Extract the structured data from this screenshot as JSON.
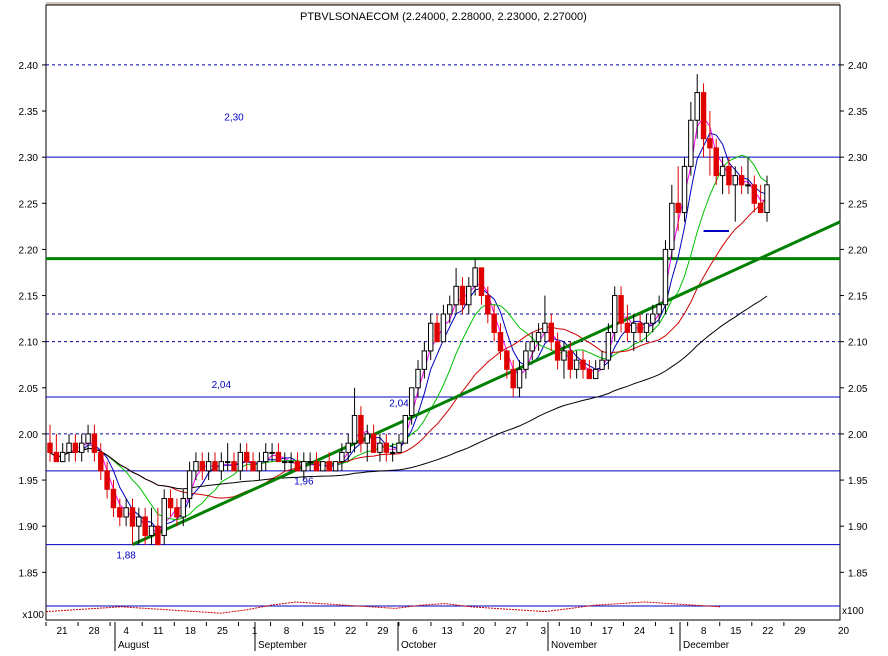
{
  "chart_data": {
    "type": "candlestick",
    "title": "PTBVLSONAECOM (2.24000, 2.28000, 2.23000, 2.27000)",
    "y_axis": {
      "min": 1.82,
      "max": 2.44,
      "ticks": [
        "2.40",
        "2.35",
        "2.30",
        "2.25",
        "2.20",
        "2.15",
        "2.10",
        "2.05",
        "2.00",
        "1.95",
        "1.90",
        "1.85"
      ],
      "tick_values": [
        2.4,
        2.35,
        2.3,
        2.25,
        2.2,
        2.15,
        2.1,
        2.05,
        2.0,
        1.95,
        1.9,
        1.85
      ]
    },
    "x_axis": {
      "day_labels": [
        "21",
        "28",
        "4",
        "11",
        "18",
        "25",
        "1",
        "8",
        "15",
        "22",
        "29",
        "6",
        "13",
        "20",
        "27",
        "3",
        "10",
        "17",
        "24",
        "1",
        "8",
        "15",
        "22",
        "29"
      ],
      "month_labels": [
        "August",
        "September",
        "October",
        "November",
        "December"
      ],
      "edge_label": "20"
    },
    "candles": [
      {
        "o": 1.99,
        "h": 2.01,
        "l": 1.97,
        "c": 1.98
      },
      {
        "o": 1.98,
        "h": 2.0,
        "l": 1.97,
        "c": 1.97
      },
      {
        "o": 1.97,
        "h": 1.99,
        "l": 1.97,
        "c": 1.98
      },
      {
        "o": 1.98,
        "h": 2.0,
        "l": 1.97,
        "c": 1.99
      },
      {
        "o": 1.99,
        "h": 2.0,
        "l": 1.97,
        "c": 1.98
      },
      {
        "o": 1.98,
        "h": 2.0,
        "l": 1.97,
        "c": 1.99
      },
      {
        "o": 1.99,
        "h": 2.01,
        "l": 1.98,
        "c": 2.0
      },
      {
        "o": 2.0,
        "h": 2.01,
        "l": 1.97,
        "c": 1.98
      },
      {
        "o": 1.98,
        "h": 1.99,
        "l": 1.95,
        "c": 1.96
      },
      {
        "o": 1.96,
        "h": 1.97,
        "l": 1.93,
        "c": 1.94
      },
      {
        "o": 1.94,
        "h": 1.95,
        "l": 1.91,
        "c": 1.92
      },
      {
        "o": 1.92,
        "h": 1.93,
        "l": 1.9,
        "c": 1.91
      },
      {
        "o": 1.91,
        "h": 1.93,
        "l": 1.9,
        "c": 1.92
      },
      {
        "o": 1.92,
        "h": 1.93,
        "l": 1.88,
        "c": 1.9
      },
      {
        "o": 1.9,
        "h": 1.92,
        "l": 1.88,
        "c": 1.91
      },
      {
        "o": 1.91,
        "h": 1.92,
        "l": 1.88,
        "c": 1.89
      },
      {
        "o": 1.89,
        "h": 1.92,
        "l": 1.88,
        "c": 1.9
      },
      {
        "o": 1.9,
        "h": 1.92,
        "l": 1.88,
        "c": 1.88
      },
      {
        "o": 1.89,
        "h": 1.94,
        "l": 1.88,
        "c": 1.93
      },
      {
        "o": 1.93,
        "h": 1.94,
        "l": 1.91,
        "c": 1.92
      },
      {
        "o": 1.92,
        "h": 1.93,
        "l": 1.9,
        "c": 1.91
      },
      {
        "o": 1.91,
        "h": 1.94,
        "l": 1.9,
        "c": 1.93
      },
      {
        "o": 1.93,
        "h": 1.97,
        "l": 1.92,
        "c": 1.96
      },
      {
        "o": 1.96,
        "h": 1.98,
        "l": 1.95,
        "c": 1.97
      },
      {
        "o": 1.97,
        "h": 1.98,
        "l": 1.95,
        "c": 1.96
      },
      {
        "o": 1.96,
        "h": 1.98,
        "l": 1.95,
        "c": 1.97
      },
      {
        "o": 1.97,
        "h": 1.98,
        "l": 1.96,
        "c": 1.96
      },
      {
        "o": 1.96,
        "h": 1.98,
        "l": 1.95,
        "c": 1.97
      },
      {
        "o": 1.97,
        "h": 1.99,
        "l": 1.96,
        "c": 1.97
      },
      {
        "o": 1.97,
        "h": 1.98,
        "l": 1.96,
        "c": 1.96
      },
      {
        "o": 1.96,
        "h": 1.99,
        "l": 1.95,
        "c": 1.98
      },
      {
        "o": 1.98,
        "h": 1.99,
        "l": 1.96,
        "c": 1.97
      },
      {
        "o": 1.97,
        "h": 1.98,
        "l": 1.96,
        "c": 1.96
      },
      {
        "o": 1.96,
        "h": 1.98,
        "l": 1.95,
        "c": 1.97
      },
      {
        "o": 1.97,
        "h": 1.99,
        "l": 1.96,
        "c": 1.98
      },
      {
        "o": 1.98,
        "h": 1.99,
        "l": 1.97,
        "c": 1.98
      },
      {
        "o": 1.98,
        "h": 1.99,
        "l": 1.97,
        "c": 1.97
      },
      {
        "o": 1.97,
        "h": 1.98,
        "l": 1.96,
        "c": 1.97
      },
      {
        "o": 1.97,
        "h": 1.98,
        "l": 1.96,
        "c": 1.97
      },
      {
        "o": 1.97,
        "h": 1.98,
        "l": 1.96,
        "c": 1.96
      },
      {
        "o": 1.96,
        "h": 1.98,
        "l": 1.95,
        "c": 1.97
      },
      {
        "o": 1.97,
        "h": 1.98,
        "l": 1.96,
        "c": 1.97
      },
      {
        "o": 1.97,
        "h": 1.98,
        "l": 1.96,
        "c": 1.96
      },
      {
        "o": 1.96,
        "h": 1.97,
        "l": 1.96,
        "c": 1.97
      },
      {
        "o": 1.97,
        "h": 1.98,
        "l": 1.96,
        "c": 1.96
      },
      {
        "o": 1.96,
        "h": 1.97,
        "l": 1.96,
        "c": 1.97
      },
      {
        "o": 1.97,
        "h": 1.99,
        "l": 1.96,
        "c": 1.98
      },
      {
        "o": 1.98,
        "h": 2.0,
        "l": 1.97,
        "c": 1.99
      },
      {
        "o": 1.99,
        "h": 2.05,
        "l": 1.98,
        "c": 2.02
      },
      {
        "o": 2.02,
        "h": 2.03,
        "l": 1.98,
        "c": 1.99
      },
      {
        "o": 1.99,
        "h": 2.01,
        "l": 1.97,
        "c": 2.0
      },
      {
        "o": 2.0,
        "h": 2.01,
        "l": 1.98,
        "c": 1.98
      },
      {
        "o": 1.98,
        "h": 2.0,
        "l": 1.97,
        "c": 1.99
      },
      {
        "o": 1.99,
        "h": 2.0,
        "l": 1.97,
        "c": 1.98
      },
      {
        "o": 1.98,
        "h": 1.99,
        "l": 1.97,
        "c": 1.98
      },
      {
        "o": 1.98,
        "h": 2.0,
        "l": 1.98,
        "c": 1.99
      },
      {
        "o": 1.99,
        "h": 2.02,
        "l": 1.99,
        "c": 2.02
      },
      {
        "o": 2.02,
        "h": 2.05,
        "l": 2.01,
        "c": 2.05
      },
      {
        "o": 2.05,
        "h": 2.08,
        "l": 2.04,
        "c": 2.07
      },
      {
        "o": 2.07,
        "h": 2.1,
        "l": 2.06,
        "c": 2.09
      },
      {
        "o": 2.09,
        "h": 2.13,
        "l": 2.08,
        "c": 2.12
      },
      {
        "o": 2.12,
        "h": 2.13,
        "l": 2.1,
        "c": 2.1
      },
      {
        "o": 2.1,
        "h": 2.14,
        "l": 2.1,
        "c": 2.13
      },
      {
        "o": 2.13,
        "h": 2.15,
        "l": 2.12,
        "c": 2.14
      },
      {
        "o": 2.14,
        "h": 2.18,
        "l": 2.13,
        "c": 2.16
      },
      {
        "o": 2.16,
        "h": 2.17,
        "l": 2.13,
        "c": 2.14
      },
      {
        "o": 2.14,
        "h": 2.17,
        "l": 2.13,
        "c": 2.16
      },
      {
        "o": 2.16,
        "h": 2.19,
        "l": 2.15,
        "c": 2.18
      },
      {
        "o": 2.18,
        "h": 2.18,
        "l": 2.14,
        "c": 2.15
      },
      {
        "o": 2.15,
        "h": 2.16,
        "l": 2.12,
        "c": 2.13
      },
      {
        "o": 2.13,
        "h": 2.14,
        "l": 2.1,
        "c": 2.11
      },
      {
        "o": 2.11,
        "h": 2.12,
        "l": 2.08,
        "c": 2.09
      },
      {
        "o": 2.09,
        "h": 2.09,
        "l": 2.06,
        "c": 2.07
      },
      {
        "o": 2.07,
        "h": 2.08,
        "l": 2.04,
        "c": 2.05
      },
      {
        "o": 2.05,
        "h": 2.08,
        "l": 2.04,
        "c": 2.07
      },
      {
        "o": 2.07,
        "h": 2.1,
        "l": 2.06,
        "c": 2.09
      },
      {
        "o": 2.09,
        "h": 2.11,
        "l": 2.08,
        "c": 2.1
      },
      {
        "o": 2.1,
        "h": 2.12,
        "l": 2.09,
        "c": 2.11
      },
      {
        "o": 2.11,
        "h": 2.15,
        "l": 2.1,
        "c": 2.12
      },
      {
        "o": 2.12,
        "h": 2.13,
        "l": 2.09,
        "c": 2.1
      },
      {
        "o": 2.1,
        "h": 2.11,
        "l": 2.07,
        "c": 2.08
      },
      {
        "o": 2.08,
        "h": 2.1,
        "l": 2.06,
        "c": 2.09
      },
      {
        "o": 2.09,
        "h": 2.1,
        "l": 2.06,
        "c": 2.07
      },
      {
        "o": 2.07,
        "h": 2.09,
        "l": 2.06,
        "c": 2.08
      },
      {
        "o": 2.08,
        "h": 2.09,
        "l": 2.06,
        "c": 2.07
      },
      {
        "o": 2.07,
        "h": 2.08,
        "l": 2.06,
        "c": 2.06
      },
      {
        "o": 2.06,
        "h": 2.08,
        "l": 2.06,
        "c": 2.07
      },
      {
        "o": 2.07,
        "h": 2.09,
        "l": 2.07,
        "c": 2.08
      },
      {
        "o": 2.08,
        "h": 2.12,
        "l": 2.07,
        "c": 2.11
      },
      {
        "o": 2.11,
        "h": 2.16,
        "l": 2.1,
        "c": 2.15
      },
      {
        "o": 2.15,
        "h": 2.16,
        "l": 2.11,
        "c": 2.12
      },
      {
        "o": 2.12,
        "h": 2.14,
        "l": 2.1,
        "c": 2.11
      },
      {
        "o": 2.11,
        "h": 2.13,
        "l": 2.09,
        "c": 2.12
      },
      {
        "o": 2.12,
        "h": 2.13,
        "l": 2.1,
        "c": 2.11
      },
      {
        "o": 2.11,
        "h": 2.13,
        "l": 2.1,
        "c": 2.12
      },
      {
        "o": 2.12,
        "h": 2.14,
        "l": 2.11,
        "c": 2.13
      },
      {
        "o": 2.13,
        "h": 2.15,
        "l": 2.12,
        "c": 2.14
      },
      {
        "o": 2.14,
        "h": 2.21,
        "l": 2.13,
        "c": 2.2
      },
      {
        "o": 2.2,
        "h": 2.27,
        "l": 2.19,
        "c": 2.25
      },
      {
        "o": 2.25,
        "h": 2.29,
        "l": 2.22,
        "c": 2.24
      },
      {
        "o": 2.24,
        "h": 2.3,
        "l": 2.23,
        "c": 2.29
      },
      {
        "o": 2.29,
        "h": 2.36,
        "l": 2.28,
        "c": 2.34
      },
      {
        "o": 2.34,
        "h": 2.39,
        "l": 2.32,
        "c": 2.37
      },
      {
        "o": 2.37,
        "h": 2.38,
        "l": 2.3,
        "c": 2.32
      },
      {
        "o": 2.32,
        "h": 2.35,
        "l": 2.28,
        "c": 2.31
      },
      {
        "o": 2.31,
        "h": 2.32,
        "l": 2.27,
        "c": 2.28
      },
      {
        "o": 2.28,
        "h": 2.3,
        "l": 2.26,
        "c": 2.29
      },
      {
        "o": 2.29,
        "h": 2.3,
        "l": 2.26,
        "c": 2.27
      },
      {
        "o": 2.27,
        "h": 2.29,
        "l": 2.23,
        "c": 2.28
      },
      {
        "o": 2.28,
        "h": 2.29,
        "l": 2.26,
        "c": 2.27
      },
      {
        "o": 2.27,
        "h": 2.3,
        "l": 2.26,
        "c": 2.27
      },
      {
        "o": 2.27,
        "h": 2.28,
        "l": 2.24,
        "c": 2.25
      },
      {
        "o": 2.25,
        "h": 2.27,
        "l": 2.24,
        "c": 2.24
      },
      {
        "o": 2.24,
        "h": 2.28,
        "l": 2.23,
        "c": 2.27
      }
    ],
    "horizontal_lines": [
      {
        "value": 2.4,
        "style": "dashed",
        "color": "#0000a0"
      },
      {
        "value": 2.3,
        "style": "solid",
        "color": "#0000c0"
      },
      {
        "value": 2.19,
        "style": "solid",
        "color": "#008000",
        "width": 3
      },
      {
        "value": 2.13,
        "style": "dashed",
        "color": "#0000a0"
      },
      {
        "value": 2.1,
        "style": "dashed",
        "color": "#0000a0"
      },
      {
        "value": 2.04,
        "style": "solid",
        "color": "#0000c0"
      },
      {
        "value": 2.0,
        "style": "dashed",
        "color": "#0000a0"
      },
      {
        "value": 1.96,
        "style": "solid",
        "color": "#0000c0"
      },
      {
        "value": 1.88,
        "style": "solid",
        "color": "#0000c0"
      }
    ],
    "trendline": {
      "from": [
        13,
        1.88
      ],
      "to": [
        115,
        2.2
      ],
      "color": "#008000"
    },
    "moving_averages": [
      {
        "color": "#ff00ff",
        "period": 3
      },
      {
        "color": "#0000c0",
        "period": 5
      },
      {
        "color": "#00c000",
        "period": 10
      },
      {
        "color": "#d00000",
        "period": 20
      },
      {
        "color": "#000000",
        "period": 60
      }
    ],
    "annotations": [
      {
        "text": "2,30",
        "index": 29,
        "y": 2.34
      },
      {
        "text": "2,04",
        "index": 27,
        "y": 2.05
      },
      {
        "text": "2,04",
        "index": 55,
        "y": 2.03
      },
      {
        "text": "1,96",
        "index": 40,
        "y": 1.945
      },
      {
        "text": "1,88",
        "index": 12,
        "y": 1.865
      }
    ],
    "short_blue_mark": {
      "index_from": 103,
      "index_to": 107,
      "y": 2.22
    },
    "volume_panel": {
      "label": "x100",
      "values": [
        0.4,
        0.5,
        0.6,
        0.7,
        0.6,
        0.5,
        0.4,
        0.3,
        0.5,
        0.8,
        1.0,
        0.9,
        0.8,
        0.7,
        0.6,
        0.8,
        0.9,
        0.7,
        0.6,
        0.5,
        0.4,
        0.6,
        0.8,
        0.9,
        1.0,
        0.9,
        0.8,
        0.7
      ]
    }
  }
}
